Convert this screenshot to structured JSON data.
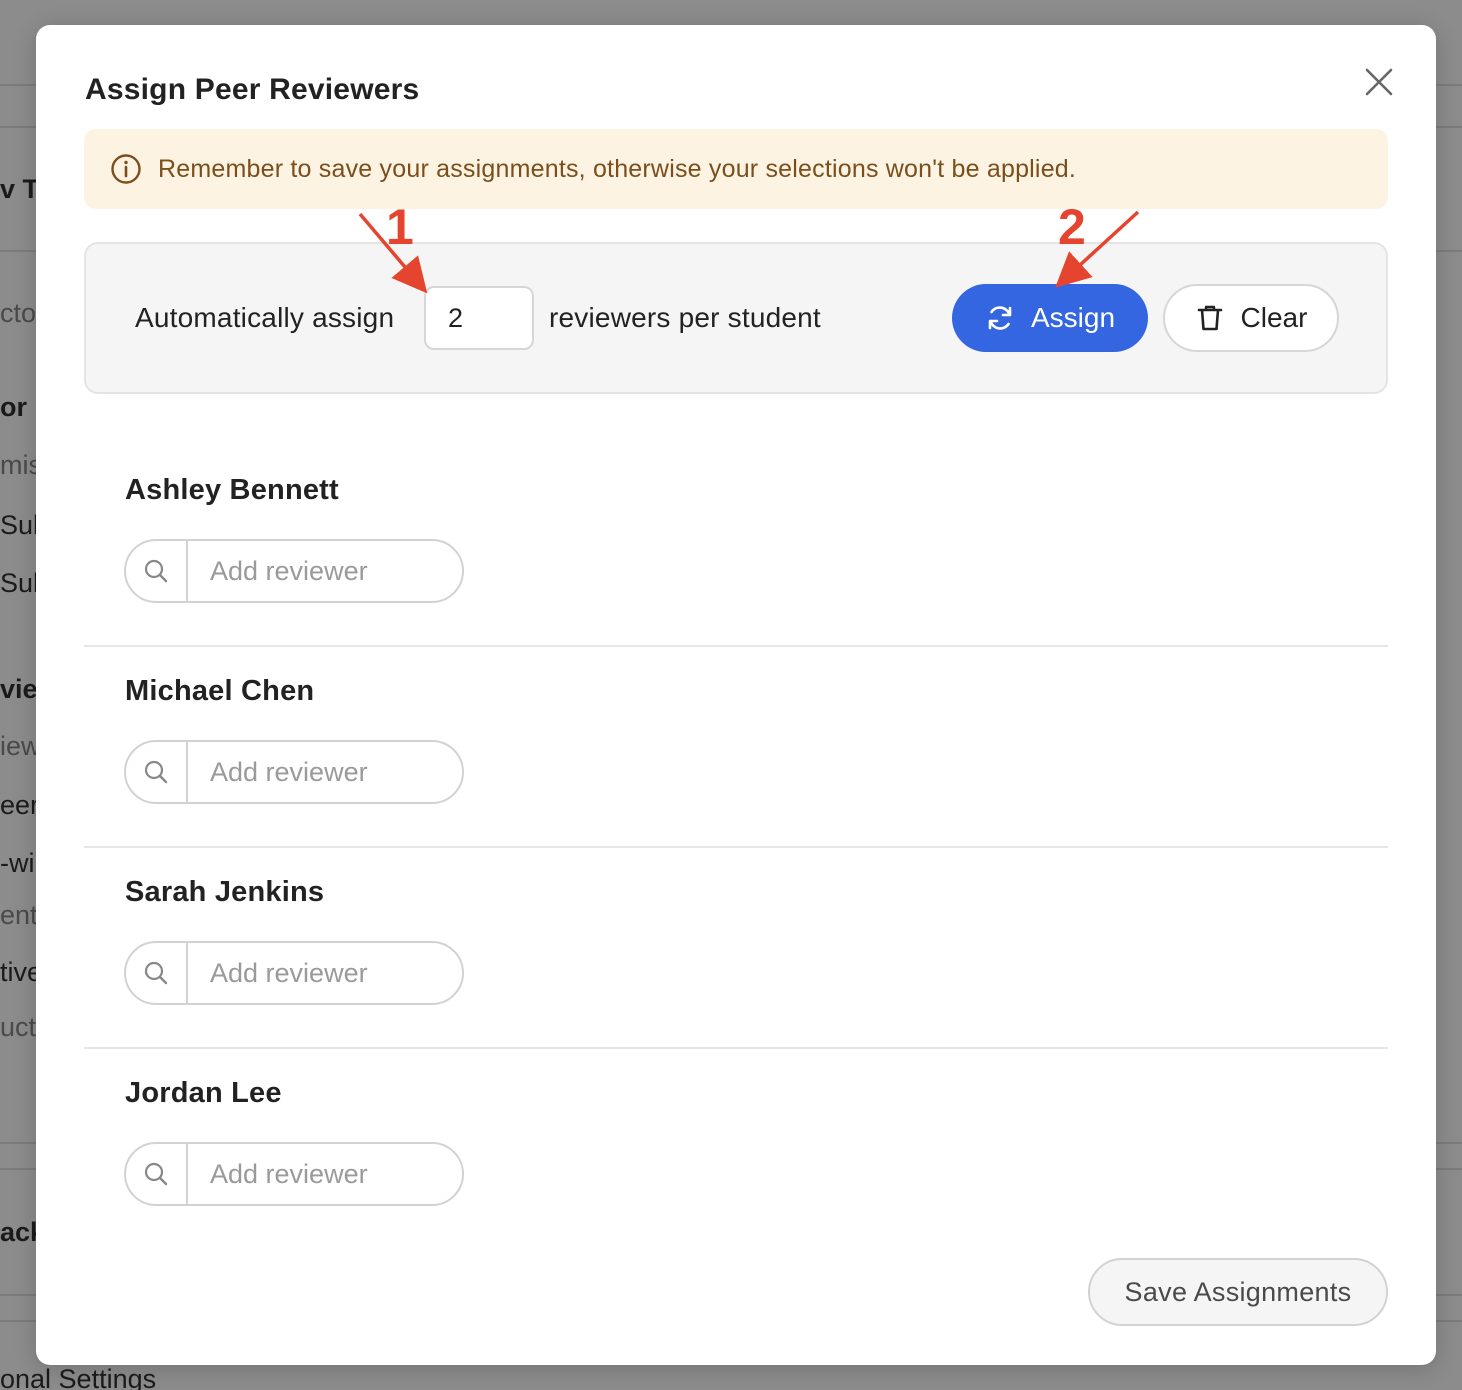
{
  "background": {
    "fragments": [
      {
        "text": "v Ty",
        "style": "bold"
      },
      {
        "text": "ctor",
        "style": "muted"
      },
      {
        "text": "or R",
        "style": "bold"
      },
      {
        "text": "miss",
        "style": "muted"
      },
      {
        "text": "Sub",
        "style": "normal"
      },
      {
        "text": "Subr",
        "style": "normal"
      },
      {
        "text": "view",
        "style": "bold"
      },
      {
        "text": "iew",
        "style": "muted"
      },
      {
        "text": "eer-",
        "style": "normal"
      },
      {
        "text": "-wi",
        "style": "normal"
      },
      {
        "text": "ent",
        "style": "muted"
      },
      {
        "text": "tive",
        "style": "normal"
      },
      {
        "text": "ucto",
        "style": "muted"
      },
      {
        "text": "ack",
        "style": "bold"
      }
    ],
    "bottom_text": "onal Settings"
  },
  "modal": {
    "title": "Assign Peer Reviewers",
    "close_icon": "close-icon",
    "banner": {
      "icon": "info-icon",
      "text": "Remember to save your assignments, otherwise your selections won't be applied."
    },
    "auto_assign": {
      "label": "Automatically assign",
      "count_value": "2",
      "suffix": "reviewers per student",
      "assign_label": "Assign",
      "assign_icon": "refresh-icon",
      "clear_label": "Clear",
      "clear_icon": "trash-icon"
    },
    "students": [
      {
        "name": "Ashley Bennett",
        "placeholder": "Add reviewer"
      },
      {
        "name": "Michael Chen",
        "placeholder": "Add reviewer"
      },
      {
        "name": "Sarah Jenkins",
        "placeholder": "Add reviewer"
      },
      {
        "name": "Jordan Lee",
        "placeholder": "Add reviewer"
      }
    ],
    "save_label": "Save Assignments"
  },
  "annotations": {
    "color": "#e5452e",
    "markers": [
      {
        "label": "1",
        "target": "reviewer-count-input"
      },
      {
        "label": "2",
        "target": "assign-button"
      }
    ]
  },
  "colors": {
    "primary": "#3366e0",
    "banner_bg": "#fdf3e3",
    "banner_text": "#7a4f1c"
  }
}
